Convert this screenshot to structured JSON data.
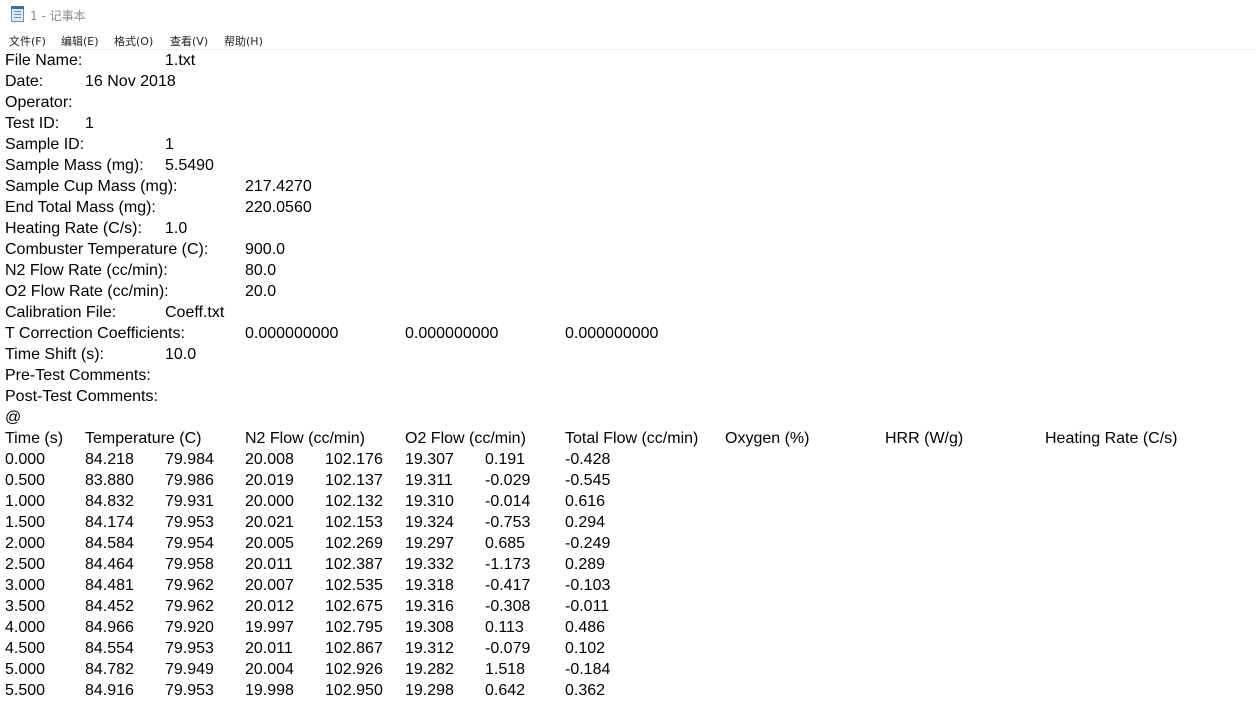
{
  "window": {
    "icon": "notepad-icon",
    "title": "1 - 记事本"
  },
  "menu": [
    {
      "label": "文件(F)"
    },
    {
      "label": "编辑(E)"
    },
    {
      "label": "格式(O)"
    },
    {
      "label": "查看(V)"
    },
    {
      "label": "帮助(H)"
    }
  ],
  "document": {
    "header_lines": [
      [
        "File Name:",
        "1.txt"
      ],
      [
        "Date:",
        "16 Nov 2018"
      ],
      [
        "Operator:"
      ],
      [
        "Test ID:",
        "1"
      ],
      [
        "Sample ID:",
        "1"
      ],
      [
        "Sample Mass (mg):",
        "5.5490"
      ],
      [
        "Sample Cup Mass (mg):",
        "217.4270"
      ],
      [
        "End Total Mass (mg):",
        "220.0560"
      ],
      [
        "Heating Rate (C/s):",
        "1.0"
      ],
      [
        "Combuster Temperature (C):",
        "900.0"
      ],
      [
        "N2 Flow Rate (cc/min):",
        "80.0"
      ],
      [
        "O2 Flow Rate (cc/min):",
        "20.0"
      ],
      [
        "Calibration File:",
        "Coeff.txt"
      ],
      [
        "T Correction Coefficients:",
        "0.000000000",
        "0.000000000",
        "0.000000000"
      ],
      [
        "Time Shift (s):",
        "10.0"
      ],
      [
        "Pre-Test Comments:"
      ],
      [
        "Post-Test Comments:"
      ],
      [
        "@"
      ]
    ],
    "table_headers": [
      "Time (s)",
      "Temperature (C)",
      "N2 Flow (cc/min)",
      "O2 Flow (cc/min)",
      "Total Flow (cc/min)",
      "Oxygen (%)",
      "HRR (W/g)",
      "Heating Rate (C/s)"
    ],
    "rows": [
      [
        "0.000",
        "84.218",
        "79.984",
        "20.008",
        "102.176",
        "19.307",
        "0.191",
        "-0.428"
      ],
      [
        "0.500",
        "83.880",
        "79.986",
        "20.019",
        "102.137",
        "19.311",
        "-0.029",
        "-0.545"
      ],
      [
        "1.000",
        "84.832",
        "79.931",
        "20.000",
        "102.132",
        "19.310",
        "-0.014",
        "0.616"
      ],
      [
        "1.500",
        "84.174",
        "79.953",
        "20.021",
        "102.153",
        "19.324",
        "-0.753",
        "0.294"
      ],
      [
        "2.000",
        "84.584",
        "79.954",
        "20.005",
        "102.269",
        "19.297",
        "0.685",
        "-0.249"
      ],
      [
        "2.500",
        "84.464",
        "79.958",
        "20.011",
        "102.387",
        "19.332",
        "-1.173",
        "0.289"
      ],
      [
        "3.000",
        "84.481",
        "79.962",
        "20.007",
        "102.535",
        "19.318",
        "-0.417",
        "-0.103"
      ],
      [
        "3.500",
        "84.452",
        "79.962",
        "20.012",
        "102.675",
        "19.316",
        "-0.308",
        "-0.011"
      ],
      [
        "4.000",
        "84.966",
        "79.920",
        "19.997",
        "102.795",
        "19.308",
        "0.113",
        "0.486"
      ],
      [
        "4.500",
        "84.554",
        "79.953",
        "20.011",
        "102.867",
        "19.312",
        "-0.079",
        "0.102"
      ],
      [
        "5.000",
        "84.782",
        "79.949",
        "20.004",
        "102.926",
        "19.282",
        "1.518",
        "-0.184"
      ],
      [
        "5.500",
        "84.916",
        "79.953",
        "19.998",
        "102.950",
        "19.298",
        "0.642",
        "0.362"
      ]
    ]
  }
}
